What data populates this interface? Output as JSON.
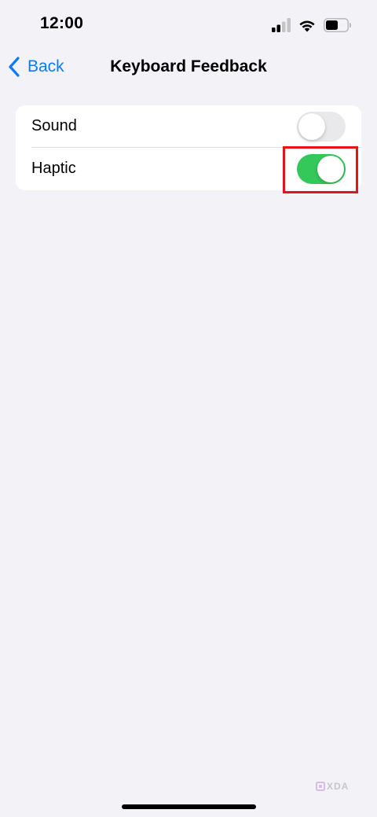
{
  "status_bar": {
    "time": "12:00",
    "icons": [
      "cellular-signal-icon",
      "wifi-icon",
      "battery-icon"
    ]
  },
  "nav": {
    "back_label": "Back",
    "title": "Keyboard Feedback"
  },
  "settings": {
    "items": [
      {
        "label": "Sound",
        "enabled": false
      },
      {
        "label": "Haptic",
        "enabled": true
      }
    ]
  },
  "annotation": {
    "highlight_target": "Haptic toggle",
    "highlight_color": "#e3151b"
  },
  "watermark": {
    "text": "XDA"
  },
  "colors": {
    "accent": "#0a7aff",
    "toggle_on": "#34c759",
    "toggle_off": "#e9e9eb",
    "background": "#f2f2f7"
  }
}
